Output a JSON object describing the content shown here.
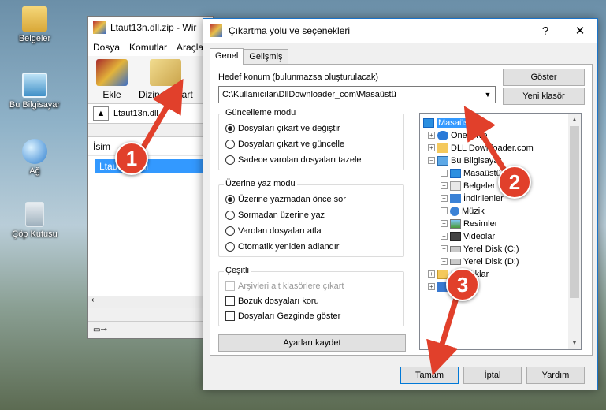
{
  "desktop": {
    "icons": [
      {
        "label": "Belgeler"
      },
      {
        "label": "Bu Bilgisayar"
      },
      {
        "label": "Ağ"
      },
      {
        "label": "Çöp Kutusu"
      }
    ]
  },
  "winrar": {
    "title": "Ltaut13n.dll.zip - Wir",
    "menu": [
      "Dosya",
      "Komutlar",
      "Araçla"
    ],
    "toolbar": {
      "add_label": "Ekle",
      "extract_label": "Dizine Çıkart"
    },
    "path": "Ltaut13n.dll",
    "column_name": "İsim",
    "file_row": "Ltaut13n.dll"
  },
  "dialog": {
    "title": "Çıkartma yolu ve seçenekleri",
    "help_symbol": "?",
    "close_symbol": "✕",
    "tabs": [
      "Genel",
      "Gelişmiş"
    ],
    "destination_label": "Hedef konum (bulunmazsa oluşturulacak)",
    "destination_value": "C:\\Kullanıcılar\\DllDownloader_com\\Masaüstü",
    "show_button": "Göster",
    "new_folder_button": "Yeni klasör",
    "update_mode": {
      "title": "Güncelleme modu",
      "options": [
        "Dosyaları çıkart ve değiştir",
        "Dosyaları çıkart ve güncelle",
        "Sadece varolan dosyaları tazele"
      ]
    },
    "overwrite_mode": {
      "title": "Üzerine yaz modu",
      "options": [
        "Üzerine yazmadan önce sor",
        "Sormadan üzerine yaz",
        "Varolan dosyaları atla",
        "Otomatik yeniden adlandır"
      ]
    },
    "misc": {
      "title": "Çeşitli",
      "options": [
        "Arşivleri alt klasörlere çıkart",
        "Bozuk dosyaları koru",
        "Dosyaları Gezginde göster"
      ]
    },
    "save_settings_button": "Ayarları kaydet",
    "tree": [
      {
        "label": "Masaüstü"
      },
      {
        "label": "OneDrive"
      },
      {
        "label": "DLL Downloader.com"
      },
      {
        "label": "Bu Bilgisayar"
      },
      {
        "label": "Masaüstü"
      },
      {
        "label": "Belgeler"
      },
      {
        "label": "İndirilenler"
      },
      {
        "label": "Müzik"
      },
      {
        "label": "Resimler"
      },
      {
        "label": "Videolar"
      },
      {
        "label": "Yerel Disk (C:)"
      },
      {
        "label": "Yerel Disk (D:)"
      },
      {
        "label": "Kitaplıklar"
      },
      {
        "label": "Ağ"
      }
    ],
    "ok_button": "Tamam",
    "cancel_button": "İptal",
    "help_button": "Yardım"
  },
  "callouts": [
    "1",
    "2",
    "3"
  ],
  "colors": {
    "callout": "#e1402b",
    "selection": "#3399ff"
  }
}
